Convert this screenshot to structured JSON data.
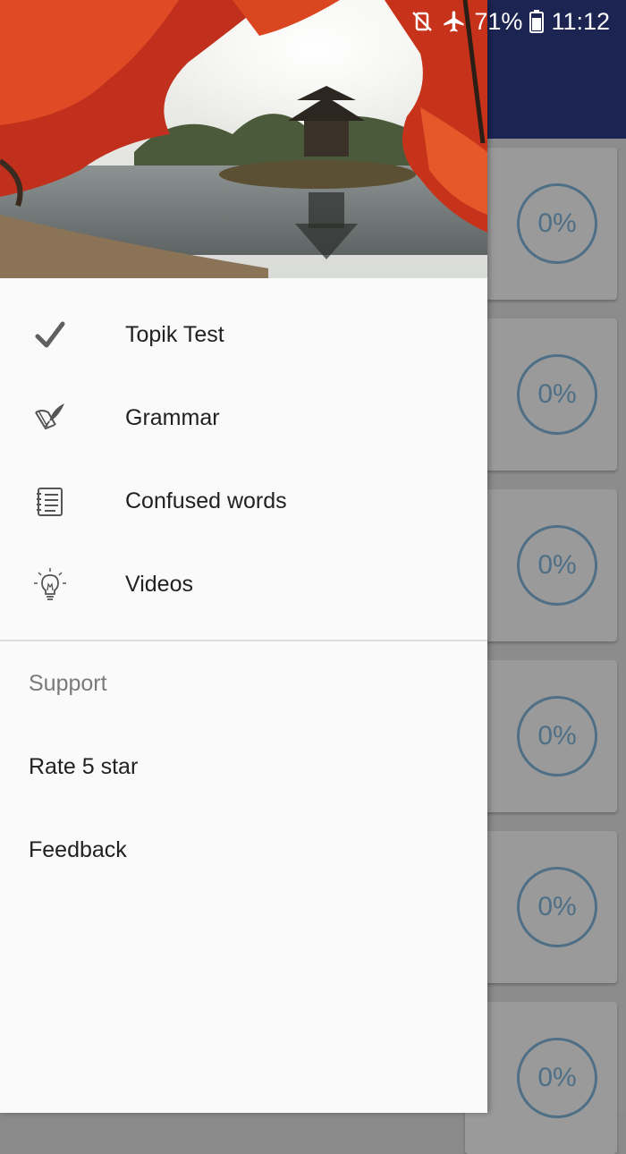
{
  "status_bar": {
    "battery": "71%",
    "time": "11:12",
    "icons": [
      "vibrate-off-icon",
      "airplane-mode-icon",
      "battery-icon"
    ]
  },
  "background_cards": [
    {
      "progress": "0%"
    },
    {
      "progress": "0%"
    },
    {
      "progress": "0%"
    },
    {
      "progress": "0%"
    },
    {
      "progress": "0%"
    },
    {
      "progress": "0%"
    }
  ],
  "drawer": {
    "menu": [
      {
        "label": "Topik Test",
        "icon": "checkmark-icon"
      },
      {
        "label": "Grammar",
        "icon": "quill-book-icon"
      },
      {
        "label": "Confused words",
        "icon": "notebook-list-icon"
      },
      {
        "label": "Videos",
        "icon": "lightbulb-icon"
      }
    ],
    "support": {
      "title": "Support",
      "items": [
        {
          "label": "Rate 5 star"
        },
        {
          "label": "Feedback"
        }
      ]
    }
  },
  "colors": {
    "app_bar": "#1c2452",
    "drawer_bg": "#fafafa",
    "progress_ring": "#4e6f86"
  }
}
